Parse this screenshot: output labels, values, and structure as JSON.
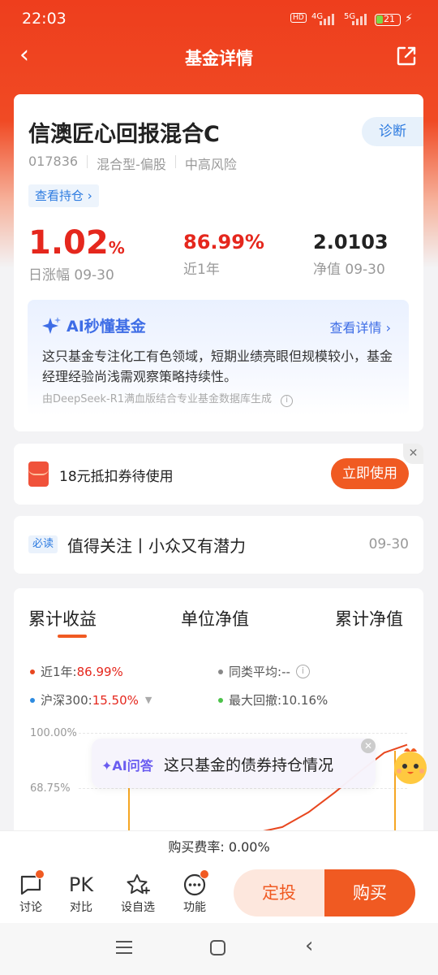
{
  "status_bar": {
    "time": "22:03",
    "hd": "HD",
    "net1": "4G",
    "net2": "5G",
    "battery": "21"
  },
  "nav": {
    "title": "基金详情"
  },
  "fund": {
    "name": "信澳匠心回报混合C",
    "code": "017836",
    "type": "混合型-偏股",
    "risk": "中高风险",
    "diagnose": "诊断",
    "holdings_link": "查看持仓",
    "daily_value": "1.02",
    "daily_unit": "%",
    "daily_label": "日涨幅 09-30",
    "year_value": "86.99%",
    "year_label": "近1年",
    "nav_value": "2.0103",
    "nav_label": "净值 09-30"
  },
  "ai_summary": {
    "title": "AI秒懂基金",
    "more": "查看详情",
    "text": "这只基金专注化工有色领域，短期业绩亮眼但规模较小，基金经理经验尚浅需观察策略持续性。",
    "source": "由DeepSeek-R1满血版结合专业基金数据库生成"
  },
  "coupon": {
    "text": "18元抵扣券待使用",
    "button": "立即使用"
  },
  "news": {
    "tag": "必读",
    "title": "值得关注丨小众又有潜力",
    "date": "09-30"
  },
  "chart_tabs": {
    "tab1": "累计收益",
    "tab2": "单位净值",
    "tab3": "累计净值"
  },
  "legend": {
    "year_label": "近1年:",
    "year_value": "86.99%",
    "peer_label": "同类平均:",
    "peer_value": "--",
    "hs_label": "沪深300:",
    "hs_value": "15.50%",
    "dd_label": "最大回撤:",
    "dd_value": "10.16%"
  },
  "chart_data": {
    "type": "line",
    "ytick_labels": [
      "100.00%",
      "68.75%"
    ],
    "series": [
      {
        "name": "近1年",
        "color": "#e8471f",
        "x": [
          0.55,
          0.62,
          0.7,
          0.78,
          0.86,
          0.93,
          1.0
        ],
        "values": [
          0,
          5,
          20,
          40,
          62,
          80,
          88
        ]
      }
    ]
  },
  "ai_float": {
    "label": "AI问答",
    "question": "这只基金的债券持仓情况"
  },
  "fee": {
    "text": "购买费率: 0.00%"
  },
  "bottom": {
    "discuss": "讨论",
    "pk_glyph": "PK",
    "pk": "对比",
    "watch": "设自选",
    "func": "功能",
    "dingtou": "定投",
    "buy": "购买"
  },
  "colors": {
    "brand": "#f05a22",
    "red": "#e5271d",
    "blue": "#2d7be0"
  }
}
